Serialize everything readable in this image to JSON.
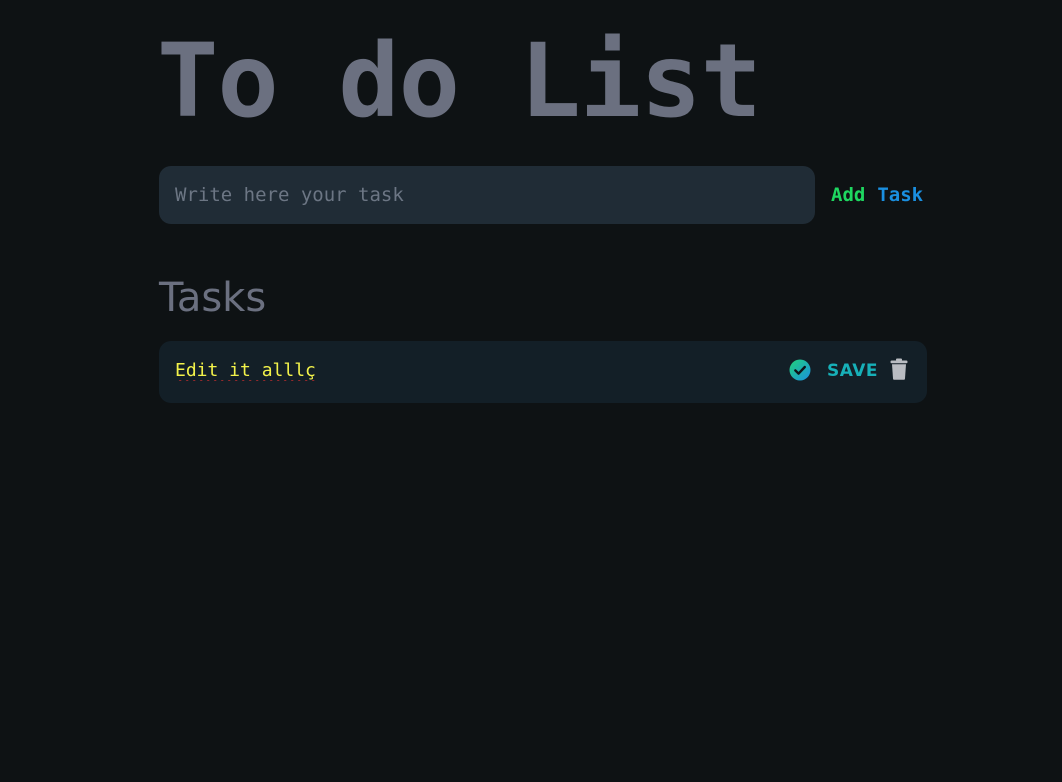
{
  "header": {
    "title": "To do List"
  },
  "add_form": {
    "input_value": "",
    "input_placeholder": "Write here your task",
    "button_label_first": "Add",
    "button_label_second": "Task"
  },
  "tasks_section": {
    "heading": "Tasks",
    "items": [
      {
        "text": "Edit it alllç",
        "editing": true,
        "save_label": "SAVE",
        "done_icon": "check-circle-icon",
        "delete_icon": "trash-icon"
      }
    ]
  },
  "colors": {
    "background": "#0e1214",
    "title": "#6b7080",
    "input_background": "#202c36",
    "task_background": "#131f27",
    "task_text": "#f2f24a",
    "accent_green": "#1ed760",
    "accent_blue": "#1a8fe0"
  }
}
